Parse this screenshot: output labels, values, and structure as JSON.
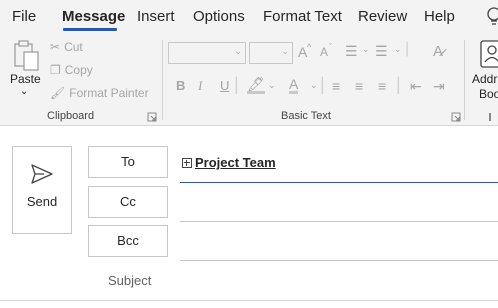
{
  "tabs": {
    "items": [
      "File",
      "Message",
      "Insert",
      "Options",
      "Format Text",
      "Review",
      "Help"
    ],
    "active": "Message"
  },
  "ribbon": {
    "clipboard": {
      "paste": "Paste",
      "cut": "Cut",
      "copy": "Copy",
      "format_painter": "Format Painter",
      "group_label": "Clipboard"
    },
    "basic_text": {
      "group_label": "Basic Text",
      "bold": "B",
      "italic": "I",
      "underline": "U",
      "font_color": "A",
      "grow_font": "A",
      "shrink_font": "A"
    },
    "names": {
      "address_book_line1": "Addr",
      "address_book_line2": "Boo"
    }
  },
  "compose": {
    "send_label": "Send",
    "to_label": "To",
    "cc_label": "Cc",
    "bcc_label": "Bcc",
    "subject_label": "Subject",
    "to_recipient": "Project Team"
  },
  "colors": {
    "accent": "#185abd",
    "ribbon_bg": "#f3f3f3",
    "disabled": "#a6a6a6"
  }
}
